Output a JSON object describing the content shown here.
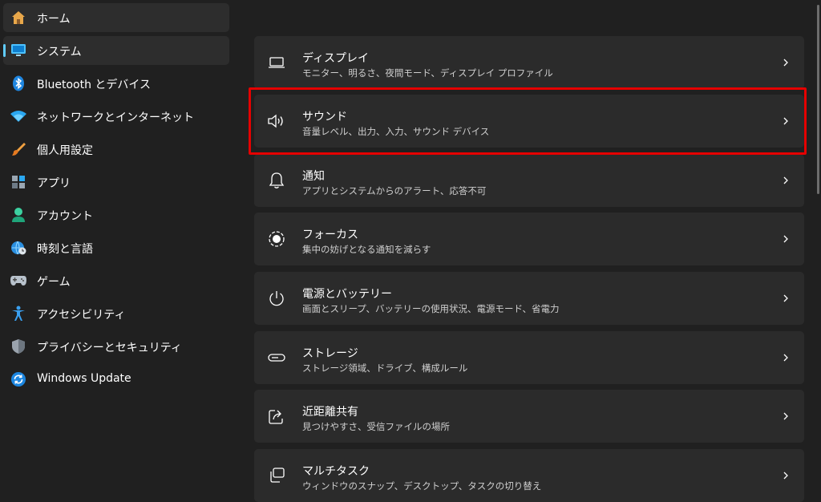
{
  "sidebar": {
    "items": [
      {
        "label": "ホーム",
        "icon": "home-icon"
      },
      {
        "label": "システム",
        "icon": "monitor-icon"
      },
      {
        "label": "Bluetooth とデバイス",
        "icon": "bluetooth-icon"
      },
      {
        "label": "ネットワークとインターネット",
        "icon": "wifi-icon"
      },
      {
        "label": "個人用設定",
        "icon": "brush-icon"
      },
      {
        "label": "アプリ",
        "icon": "apps-icon"
      },
      {
        "label": "アカウント",
        "icon": "person-icon"
      },
      {
        "label": "時刻と言語",
        "icon": "globe-clock-icon"
      },
      {
        "label": "ゲーム",
        "icon": "gamepad-icon"
      },
      {
        "label": "アクセシビリティ",
        "icon": "accessibility-icon"
      },
      {
        "label": "プライバシーとセキュリティ",
        "icon": "shield-icon"
      },
      {
        "label": "Windows Update",
        "icon": "update-icon"
      }
    ]
  },
  "cards": [
    {
      "title": "ディスプレイ",
      "subtitle": "モニター、明るさ、夜間モード、ディスプレイ プロファイル",
      "icon": "display-icon"
    },
    {
      "title": "サウンド",
      "subtitle": "音量レベル、出力、入力、サウンド デバイス",
      "icon": "speaker-icon"
    },
    {
      "title": "通知",
      "subtitle": "アプリとシステムからのアラート、応答不可",
      "icon": "bell-icon"
    },
    {
      "title": "フォーカス",
      "subtitle": "集中の妨げとなる通知を減らす",
      "icon": "focus-icon"
    },
    {
      "title": "電源とバッテリー",
      "subtitle": "画面とスリープ、バッテリーの使用状況、電源モード、省電力",
      "icon": "power-icon"
    },
    {
      "title": "ストレージ",
      "subtitle": "ストレージ領域、ドライブ、構成ルール",
      "icon": "storage-icon"
    },
    {
      "title": "近距離共有",
      "subtitle": "見つけやすさ、受信ファイルの場所",
      "icon": "share-icon"
    },
    {
      "title": "マルチタスク",
      "subtitle": "ウィンドウのスナップ、デスクトップ、タスクの切り替え",
      "icon": "multitask-icon"
    }
  ],
  "colors": {
    "accent": "#60cdff",
    "highlight": "#e50000",
    "background": "#202020",
    "card": "#2b2b2b"
  }
}
